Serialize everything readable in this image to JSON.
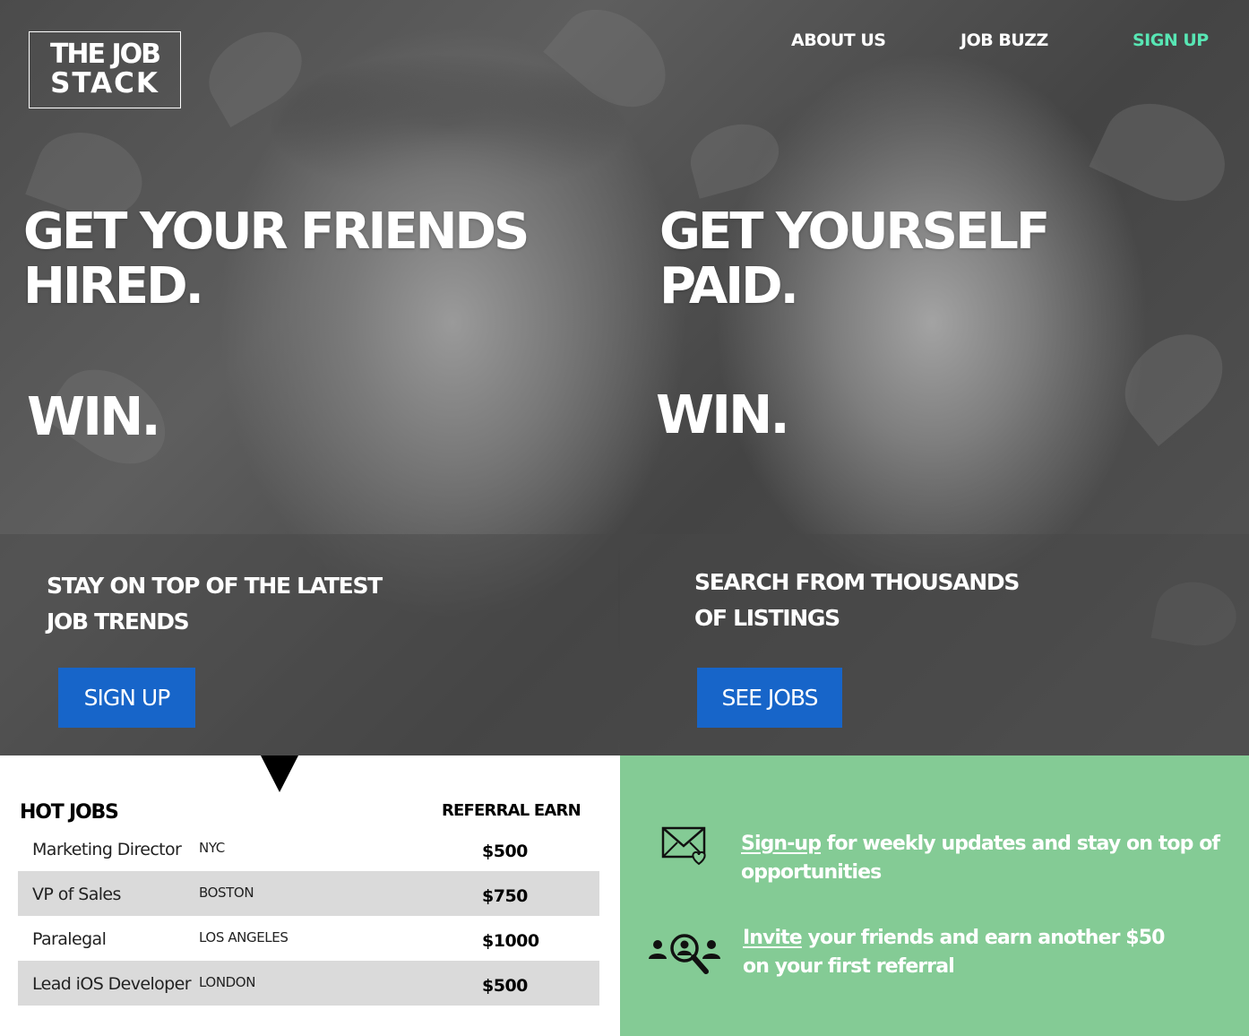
{
  "logo": {
    "line1": "THE JOB",
    "line2": "STACK"
  },
  "nav": {
    "about": "ABOUT US",
    "buzz": "JOB BUZZ",
    "signup": "SIGN UP"
  },
  "hero": {
    "left_headline_1": "GET YOUR FRIENDS",
    "left_headline_2": "HIRED.",
    "left_win": "WIN.",
    "right_headline_1": "GET YOURSELF",
    "right_headline_2": "PAID.",
    "right_win": "WIN."
  },
  "panels": {
    "left_text_1": "STAY ON TOP OF THE LATEST",
    "left_text_2": "JOB TRENDS",
    "left_button": "SIGN UP",
    "right_text_1": "SEARCH FROM THOUSANDS",
    "right_text_2": "OF LISTINGS",
    "right_button": "SEE JOBS"
  },
  "hot_jobs": {
    "title": "HOT JOBS",
    "referral_header": "REFERRAL EARN",
    "rows": [
      {
        "title": "Marketing Director",
        "city": "NYC",
        "pay": "$500"
      },
      {
        "title": "VP of Sales",
        "city": "BOSTON",
        "pay": "$750"
      },
      {
        "title": "Paralegal",
        "city": "LOS ANGELES",
        "pay": "$1000"
      },
      {
        "title": "Lead iOS Developer",
        "city": "LONDON",
        "pay": "$500"
      }
    ]
  },
  "promos": {
    "signup_link": "Sign-up",
    "signup_text_1": " for weekly updates and stay on top of",
    "signup_text_2": "opportunities",
    "invite_link": "Invite",
    "invite_text_1": " your friends and earn another $50",
    "invite_text_2": "on your first referral",
    "signup_icon": "mail-heart-icon",
    "invite_icon": "people-search-icon"
  },
  "colors": {
    "accent_nav": "#58e6b4",
    "button_blue": "#1765c9",
    "green_panel": "#84cb95",
    "row_alt": "#dadada"
  }
}
